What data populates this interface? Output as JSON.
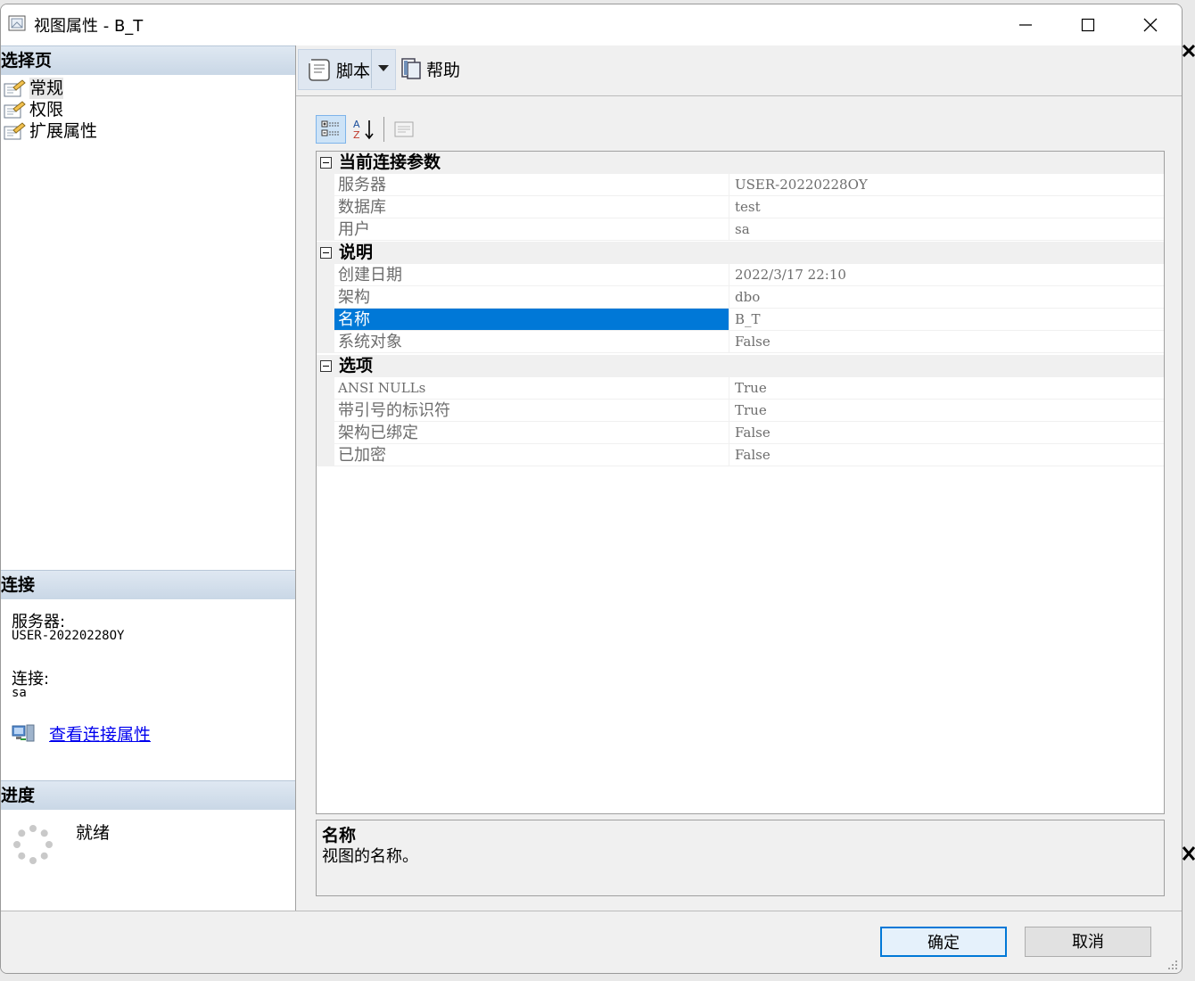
{
  "window": {
    "title": "视图属性 - B_T"
  },
  "left_pane": {
    "select_page": {
      "header": "选择页",
      "items": [
        {
          "label": "常规",
          "selected": true
        },
        {
          "label": "权限",
          "selected": false
        },
        {
          "label": "扩展属性",
          "selected": false
        }
      ]
    },
    "connection": {
      "header": "连接",
      "server_label": "服务器:",
      "server_value": "USER-20220228OY",
      "connection_label": "连接:",
      "connection_value": "sa",
      "view_props_link": "查看连接属性"
    },
    "progress": {
      "header": "进度",
      "status": "就绪"
    }
  },
  "toolbar": {
    "script_label": "脚本",
    "help_label": "帮助"
  },
  "property_grid": {
    "categories": [
      {
        "name": "当前连接参数",
        "rows": [
          {
            "name": "服务器",
            "value": "USER-20220228OY"
          },
          {
            "name": "数据库",
            "value": "test"
          },
          {
            "name": "用户",
            "value": "sa"
          }
        ]
      },
      {
        "name": "说明",
        "rows": [
          {
            "name": "创建日期",
            "value": "2022/3/17 22:10"
          },
          {
            "name": "架构",
            "value": "dbo"
          },
          {
            "name": "名称",
            "value": "B_T",
            "selected": true
          },
          {
            "name": "系统对象",
            "value": "False"
          }
        ]
      },
      {
        "name": "选项",
        "rows": [
          {
            "name": "ANSI NULLs",
            "value": "True"
          },
          {
            "name": "带引号的标识符",
            "value": "True"
          },
          {
            "name": "架构已绑定",
            "value": "False"
          },
          {
            "name": "已加密",
            "value": "False"
          }
        ]
      }
    ]
  },
  "description": {
    "title": "名称",
    "text": "视图的名称。"
  },
  "footer": {
    "ok_label": "确定",
    "cancel_label": "取消"
  },
  "colors": {
    "selection": "#0078d7",
    "link": "#0000ee",
    "section_header": "#c9d7e6"
  }
}
